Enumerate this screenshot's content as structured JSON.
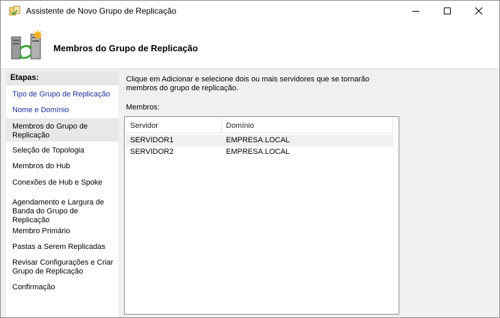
{
  "window": {
    "title": "Assistente de Novo Grupo de Replicação",
    "icon": "replication-wizard-icon"
  },
  "header": {
    "title": "Membros do Grupo de Replicação",
    "icon": "server-replication-icon"
  },
  "steps": {
    "heading": "Etapas:",
    "items": [
      {
        "label": "Tipo de Grupo de Replicação",
        "state": "done"
      },
      {
        "label": "Nome e Domínio",
        "state": "done"
      },
      {
        "label": "Membros do Grupo de Replicação",
        "state": "current"
      },
      {
        "label": "Seleção de Topologia",
        "state": "pending"
      },
      {
        "label": "Membros do Hub",
        "state": "pending"
      },
      {
        "label": "Conexões de Hub e Spoke",
        "state": "pending"
      },
      {
        "label": "Agendamento e Largura de Banda do Grupo de Replicação",
        "state": "pending"
      },
      {
        "label": "Membro Primário",
        "state": "pending"
      },
      {
        "label": "Pastas a Serem Replicadas",
        "state": "pending"
      },
      {
        "label": "Revisar Configurações e Criar Grupo de Replicação",
        "state": "pending"
      },
      {
        "label": "Confirmação",
        "state": "pending"
      }
    ]
  },
  "main": {
    "instructions": "Clique em Adicionar e selecione dois ou mais servidores que se tornarão membros do grupo de replicação.",
    "members_label": "Membros:",
    "table": {
      "columns": [
        "Servidor",
        "Domínio"
      ],
      "rows": [
        [
          "SERVIDOR1",
          "EMPRESA.LOCAL"
        ],
        [
          "SERVIDOR2",
          "EMPRESA.LOCAL"
        ]
      ]
    }
  },
  "colors": {
    "link_step": "#1a2f9c",
    "selected_row": "#f0f0f0",
    "window_bg": "#f0f0f0"
  }
}
